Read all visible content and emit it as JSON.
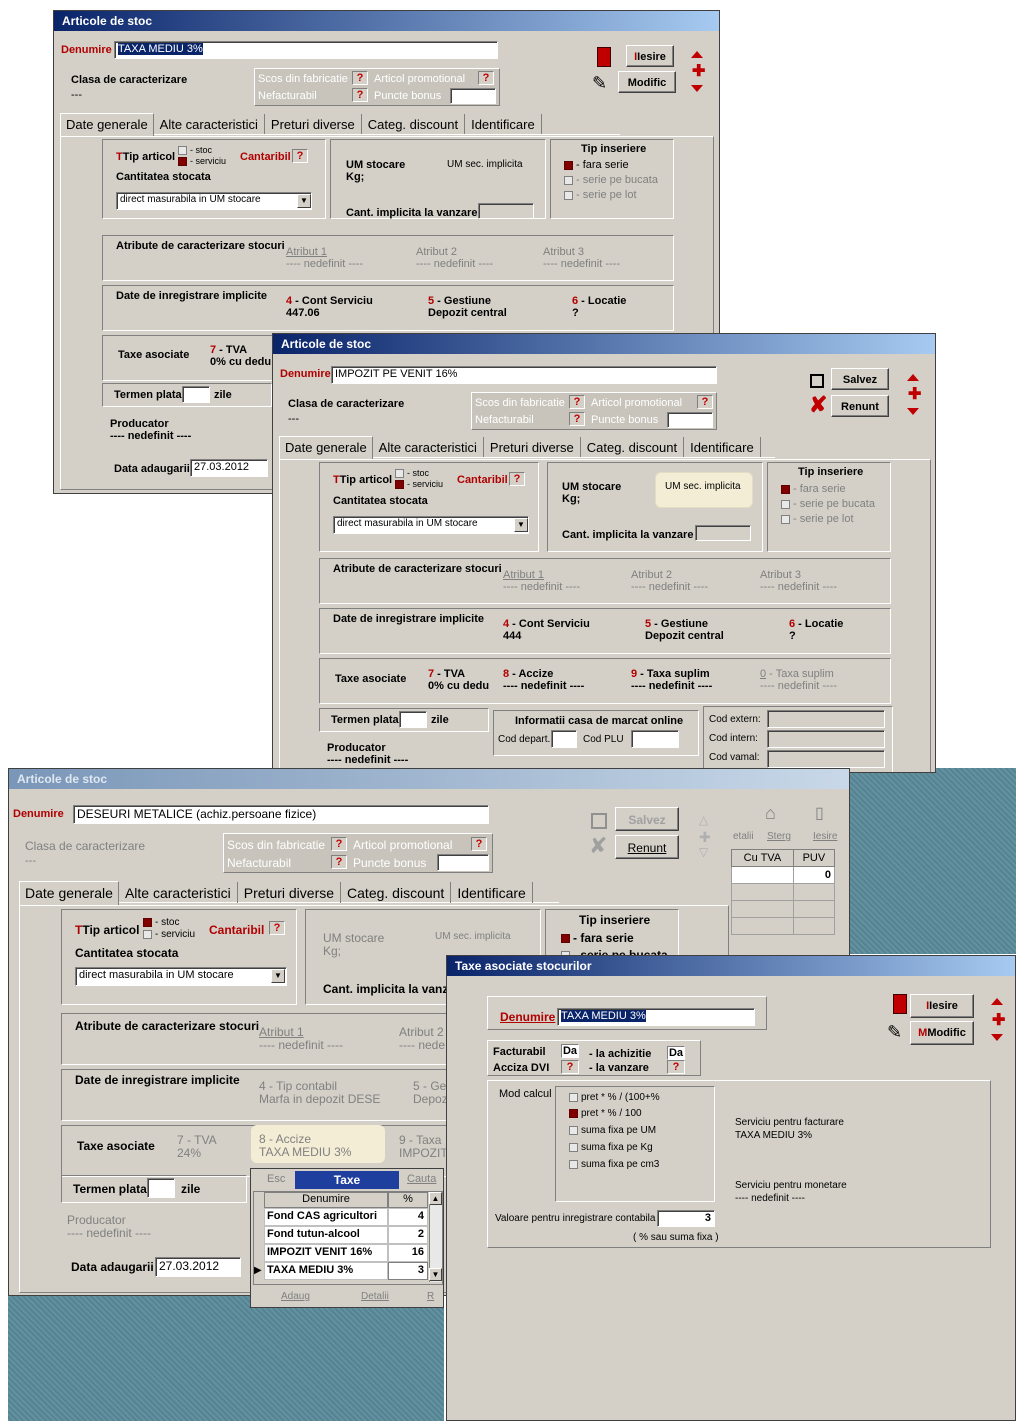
{
  "w1": {
    "title": "Articole de stoc",
    "denumire_label": "Denumire",
    "denumire_value": "TAXA MEDIU 3%",
    "clasa_label": "Clasa de caracterizare",
    "clasa_value": "---",
    "scos_label": "Scos din fabricatie",
    "articol_prom_label": "Articol promotional",
    "nefact_label": "Nefacturabil",
    "puncte_label": "Puncte bonus",
    "q": "?",
    "iesire_label": "Iesire",
    "modific_label": "Modific",
    "tabs": [
      "Date generale",
      "Alte caracteristici",
      "Preturi diverse",
      "Categ. discount",
      "Identificare"
    ],
    "tip_articol_label": "Tip articol",
    "opt_stoc": "- stoc",
    "opt_serviciu": "- serviciu",
    "cantaribil_label": "Cantaribil",
    "cantitatea_label": "Cantitatea stocata",
    "cantitatea_value": "direct masurabila in UM stocare",
    "um_stocare_label": "UM stocare",
    "um_stocare_value": "Kg;",
    "um_sec_label": "UM sec. implicita",
    "cant_impl_label": "Cant. implicita la vanzare",
    "tip_inseriere_label": "Tip inseriere",
    "ins1": "- fara serie",
    "ins2": "- serie pe bucata",
    "ins3": "- serie pe lot",
    "atribute_label": "Atribute de caracterizare stocuri",
    "atr1": "Atribut 1",
    "atr2": "Atribut 2",
    "atr3": "Atribut 3",
    "nedefinit": "---- nedefinit ----",
    "date_inreg_label": "Date de inregistrare implicite",
    "cont_key": "4",
    "cont_label": " - Cont Serviciu",
    "cont_value": "447.06",
    "gest_key": "5",
    "gest_label": " - Gestiune",
    "gest_value": "Depozit central",
    "loc_key": "6",
    "loc_label": " - Locatie",
    "loc_value": "?",
    "taxe_label": "Taxe asociate",
    "tva_key": "7",
    "tva_label": " - TVA",
    "tva_value": "0% cu dedu",
    "termen_label": "Termen plata",
    "zile": "zile",
    "producator_label": "Producator",
    "producator_value": "---- nedefinit ----",
    "data_adaugarii_label": "Data adaugarii",
    "data_adaugarii_value": "27.03.2012"
  },
  "w2": {
    "title": "Articole de stoc",
    "denumire_label": "Denumire",
    "denumire_value": "IMPOZIT PE VENIT 16%",
    "clasa_label": "Clasa de caracterizare",
    "clasa_value": "---",
    "scos_label": "Scos din fabricatie",
    "articol_prom_label": "Articol promotional",
    "nefact_label": "Nefacturabil",
    "puncte_label": "Puncte bonus",
    "q": "?",
    "salvez_label": "Salvez",
    "renunt_label": "Renunt",
    "tabs": [
      "Date generale",
      "Alte caracteristici",
      "Preturi diverse",
      "Categ. discount",
      "Identificare"
    ],
    "tip_articol_label": "Tip articol",
    "opt_stoc": "- stoc",
    "opt_serviciu": "- serviciu",
    "cantaribil_label": "Cantaribil",
    "cantitatea_label": "Cantitatea stocata",
    "cantitatea_value": "direct masurabila in UM stocare",
    "um_stocare_label": "UM stocare",
    "um_stocare_value": "Kg;",
    "um_sec_label": "UM sec. implicita",
    "cant_impl_label": "Cant. implicita la vanzare",
    "tip_inseriere_label": "Tip inseriere",
    "ins1": "- fara serie",
    "ins2": "- serie pe bucata",
    "ins3": "- serie pe lot",
    "atribute_label": "Atribute de caracterizare stocuri",
    "atr1": "Atribut 1",
    "atr2": "Atribut 2",
    "atr3": "Atribut 3",
    "nedefinit": "---- nedefinit ----",
    "date_inreg_label": "Date de inregistrare implicite",
    "cont_key": "4",
    "cont_label": " - Cont Serviciu",
    "cont_value": "444",
    "gest_key": "5",
    "gest_label": " - Gestiune",
    "gest_value": "Depozit central",
    "loc_key": "6",
    "loc_label": " - Locatie",
    "loc_value": "?",
    "taxe_label": "Taxe asociate",
    "tva_key": "7",
    "tva_label": " - TVA",
    "tva_value": "0% cu dedu",
    "accize_key": "8",
    "accize_label": " - Accize",
    "accize_value": "---- nedefinit ----",
    "ts1_key": "9",
    "ts1_label": " - Taxa suplim",
    "ts1_value": "---- nedefinit ----",
    "ts2_key": "0",
    "ts2_label": " - Taxa suplim",
    "ts2_value": "---- nedefinit ----",
    "termen_label": "Termen plata",
    "zile": "zile",
    "casa_label": "Informatii casa de marcat online",
    "cod_depart": "Cod depart.",
    "cod_plu": "Cod PLU",
    "cod_extern": "Cod extern:",
    "cod_intern": "Cod intern:",
    "cod_vamal": "Cod vamal:",
    "producator_label": "Producator",
    "producator_value": "---- nedefinit ----"
  },
  "w3": {
    "title": "Articole de stoc",
    "denumire_label": "Denumire",
    "denumire_value": "DESEURI METALICE (achiz.persoane fizice)",
    "clasa_label": "Clasa de caracterizare",
    "clasa_value": "---",
    "scos_label": "Scos din fabricatie",
    "articol_prom_label": "Articol promotional",
    "nefact_label": "Nefacturabil",
    "puncte_label": "Puncte bonus",
    "q": "?",
    "salvez_label": "Salvez",
    "renunt_label": "Renunt",
    "tabs": [
      "Date generale",
      "Alte caracteristici",
      "Preturi diverse",
      "Categ. discount",
      "Identificare"
    ],
    "tip_articol_label": "Tip articol",
    "opt_stoc": "- stoc",
    "opt_serviciu": "- serviciu",
    "cantaribil_label": "Cantaribil",
    "cantitatea_label": "Cantitatea stocata",
    "cantitatea_value": "direct masurabila in UM stocare",
    "um_stocare_label": "UM stocare",
    "um_stocare_value": "Kg;",
    "um_sec_label": "UM sec. implicita",
    "cant_impl_label": "Cant. implicita la vanzar",
    "tip_inseriere_label": "Tip inseriere",
    "ins1": "- fara serie",
    "ins2": "- serie pe bucata",
    "atribute_label": "Atribute de caracterizare stocuri",
    "atr1": "Atribut 1",
    "atr2": "Atribut 2",
    "nedefinit": "---- nedefinit ----",
    "nedefinit_short": "---- nede",
    "date_inreg_label": "Date de inregistrare implicite",
    "tip_contabil": "4 - Tip contabil",
    "tip_contabil_value": "Marfa in depozit DESE",
    "gest_trunc": "5 - Ge",
    "gest_val_trunc": "Depoz",
    "taxe_label": "Taxe asociate",
    "tva_label": "7 - TVA",
    "tva_value": "24%",
    "accize_label": "8 - Accize",
    "accize_value": "TAXA MEDIU 3%",
    "taxa9_label": "9 - Taxa",
    "taxa9_value": "IMPOZIT",
    "termen_label": "Termen plata",
    "zile": "zile",
    "producator_label": "Producator",
    "producator_value": "---- nedefinit ----",
    "data_adaugarii_label": "Data adaugarii",
    "data_adaugarii_value": "27.03.2012"
  },
  "bg": {
    "detalii": "etalii",
    "sterg": "Sterg",
    "iesire": "Iesire",
    "cu_tva": "Cu TVA",
    "puv": "PUV",
    "puv_value": "0"
  },
  "taxe": {
    "esc": "Esc",
    "title": "Taxe",
    "cauta": "Cauta",
    "col_den": "Denumire",
    "col_pct": "%",
    "rows": [
      {
        "name": "Fond CAS agricultori",
        "pct": "4"
      },
      {
        "name": "Fond tutun-alcool",
        "pct": "2"
      },
      {
        "name": "IMPOZIT VENIT 16%",
        "pct": "16"
      },
      {
        "name": "TAXA MEDIU 3%",
        "pct": "3"
      }
    ],
    "adaug": "Adaug",
    "detalii": "Detalii",
    "r": "R"
  },
  "w4": {
    "title": "Taxe asociate stocurilor",
    "denumire_label": "Denumire",
    "denumire_value": "TAXA MEDIU 3%",
    "iesire_label": "Iesire",
    "modific_label": "Modific",
    "facturabil_label": "Facturabil",
    "facturabil_value": "Da",
    "achizitie_label": "- la achizitie",
    "achizitie_value": "Da",
    "acciza_label": "Acciza DVI",
    "acciza_value": "?",
    "vanzare_label": "- la vanzare",
    "vanzare_value": "?",
    "mod_calcul_label": "Mod calcul",
    "mod_options": [
      "pret * % / (100+%",
      "pret * % / 100",
      "suma fixa pe UM",
      "suma fixa pe Kg",
      "suma fixa pe cm3"
    ],
    "serv_fact_label": "Serviciu pentru facturare",
    "serv_fact_value": "TAXA MEDIU 3%",
    "serv_mon_label": "Serviciu pentru monetare",
    "serv_mon_value": "---- nedefinit ----",
    "valoare_label": "Valoare pentru inregistrare contabila",
    "valoare_value": "3",
    "valoare_note": "( % sau suma fixa )"
  },
  "colors": {
    "title_active": "#0a246a",
    "red_label": "#b00000",
    "face": "#d4d0c8"
  }
}
